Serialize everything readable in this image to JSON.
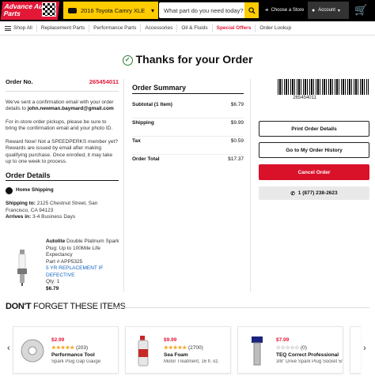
{
  "header": {
    "logo": "Advance Auto Parts",
    "vehicle": "2016 Toyota Camry XLE",
    "search_placeholder": "What part do you need today?",
    "store_label": "Choose a Store",
    "account_label": "Account"
  },
  "nav": {
    "shop_all": "Shop All",
    "items": [
      "Replacement Parts",
      "Performance Parts",
      "Accessories",
      "Oil & Fluids",
      "Special Offers",
      "Order Lookup"
    ]
  },
  "thanks": "Thanks for your Order",
  "order": {
    "label": "Order No.",
    "number": "265454011",
    "confirm_text": "We've sent a confirmation email with your order details to",
    "email": "john.newman.baymard@gmail.com",
    "pickup_text": "For in-store order pickups, please be sure to bring the confirmation email and your photo ID.",
    "reward_text": "Reward Now! Not a SPEEDPERKS  member yet? Rewards are issued by email after making qualifying purchase. Once enrolled, it may take up to one week to process."
  },
  "details": {
    "title": "Order Details",
    "shipping_mode": "Home Shipping",
    "ship_label": "Shipping to:",
    "ship_address": "2125 Chestnut Street, San Francisco, CA 94123",
    "arrives_label": "Arrives in:",
    "arrives": "3-4 Business Days",
    "brand": "Autolite",
    "product": "Double Platinum Spark Plug: Up to 100Mile Life Expectancy",
    "part_no": "Part # APP5325",
    "warranty": "5 YR REPLACEMENT IF DEFECTIVE",
    "qty": "Qty: 1",
    "price": "$6.79"
  },
  "summary": {
    "title": "Order Summary",
    "rows": [
      {
        "label": "Subtotal (1 Item)",
        "value": "$6.79"
      },
      {
        "label": "Shipping",
        "value": "$9.99"
      },
      {
        "label": "Tax",
        "value": "$0.59"
      },
      {
        "label": "Order Total",
        "value": "$17.37"
      }
    ]
  },
  "actions": {
    "barcode_number": "265454011",
    "print": "Print Order Details",
    "goto": "Go to My Order History",
    "cancel": "Cancel Order",
    "phone": "1 (877) 238-2623"
  },
  "forget": {
    "title_bold": "DON'T",
    "title_rest": "FORGET THESE ITEMS",
    "items": [
      {
        "price": "$2.99",
        "stars": "★★★★★",
        "reviews": "(203)",
        "name": "Performance Tool",
        "desc": "Spark Plug Gap Gauge"
      },
      {
        "price": "$9.99",
        "stars": "★★★★★",
        "reviews": "(2700)",
        "name": "Sea Foam",
        "desc": "Motor Treatment, 16 fl. oz."
      },
      {
        "price": "$7.99",
        "stars": "☆☆☆☆☆",
        "reviews": "(0)",
        "name": "TEQ Correct Professional",
        "desc": "3/8\" Drive Spark Plug Socket 5/..."
      }
    ]
  },
  "colors": {
    "brand_red": "#e31837",
    "brand_yellow": "#ffcc00"
  }
}
